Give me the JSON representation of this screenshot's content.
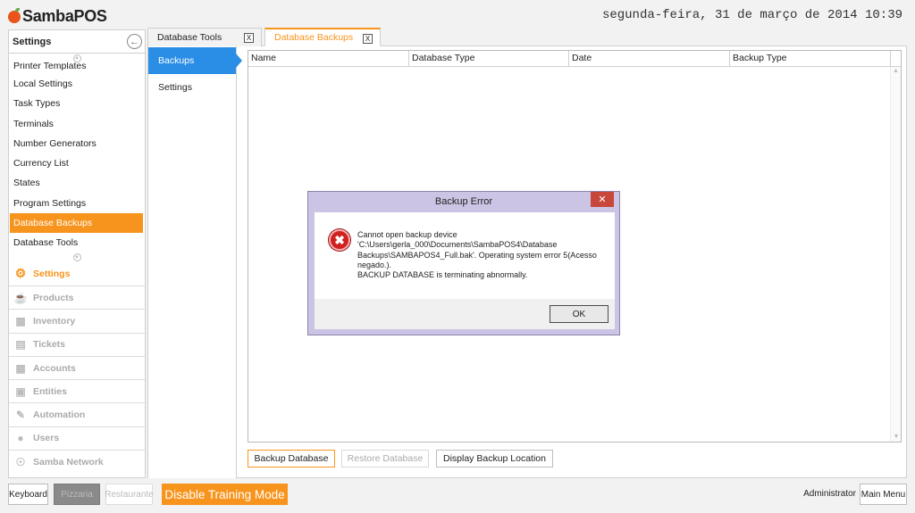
{
  "app": {
    "name": "SambaPOS",
    "datetime": "segunda-feira, 31 de março de 2014 10:39"
  },
  "sidebar": {
    "title": "Settings",
    "items": [
      {
        "label": "Printer Templates"
      },
      {
        "label": "Local Settings"
      },
      {
        "label": "Task Types"
      },
      {
        "label": "Terminals"
      },
      {
        "label": "Number Generators"
      },
      {
        "label": "Currency List"
      },
      {
        "label": "States"
      },
      {
        "label": "Program Settings"
      },
      {
        "label": "Database Backups",
        "active": true
      },
      {
        "label": "Database Tools"
      }
    ],
    "sections": [
      {
        "label": "Settings",
        "icon": "gear-icon",
        "active": true
      },
      {
        "label": "Products",
        "icon": "cup-icon"
      },
      {
        "label": "Inventory",
        "icon": "inventory-icon"
      },
      {
        "label": "Tickets",
        "icon": "tickets-icon"
      },
      {
        "label": "Accounts",
        "icon": "calculator-icon"
      },
      {
        "label": "Entities",
        "icon": "entities-icon"
      },
      {
        "label": "Automation",
        "icon": "pencil-icon"
      },
      {
        "label": "Users",
        "icon": "user-icon"
      },
      {
        "label": "Samba Network",
        "icon": "globe-icon"
      }
    ]
  },
  "tabs": [
    {
      "label": "Database Tools",
      "close": "X"
    },
    {
      "label": "Database Backups",
      "close": "X",
      "active": true
    }
  ],
  "subnav": [
    {
      "label": "Backups",
      "active": true
    },
    {
      "label": "Settings"
    }
  ],
  "grid": {
    "columns": [
      "Name",
      "Database Type",
      "Date",
      "Backup Type"
    ],
    "rows": []
  },
  "actions": {
    "backup": "Backup Database",
    "restore": "Restore Database",
    "display_location": "Display Backup Location"
  },
  "bottom": {
    "keyboard": "Keyboard",
    "pizzaria": "Pizzaria",
    "restaurante": "Restaurante",
    "training": "Disable Training Mode",
    "user": "Administrator",
    "main_menu": "Main Menu"
  },
  "dialog": {
    "title": "Backup Error",
    "close": "✕",
    "lines": [
      "Cannot open backup device",
      "'C:\\Users\\gerla_000\\Documents\\SambaPOS4\\Database",
      "Backups\\SAMBAPOS4_Full.bak'. Operating system error 5(Acesso",
      "negado.).",
      "BACKUP DATABASE is terminating abnormally."
    ],
    "ok": "OK"
  },
  "colors": {
    "accent": "#f7941d",
    "selection": "#2a8ee6",
    "error": "#d02020"
  }
}
